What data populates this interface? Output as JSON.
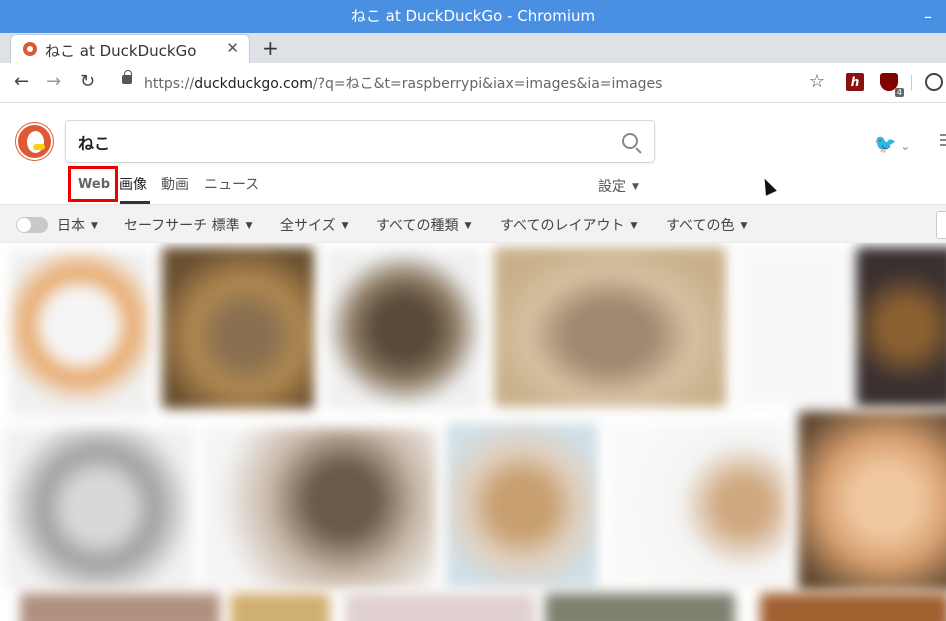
{
  "window": {
    "title": "ねこ at DuckDuckGo - Chromium",
    "minimize_glyph": "–"
  },
  "tab": {
    "title": "ねこ at DuckDuckGo",
    "close_glyph": "✕",
    "new_tab_glyph": "+"
  },
  "toolbar": {
    "back_glyph": "←",
    "forward_glyph": "→",
    "reload_glyph": "↻",
    "url_scheme": "https://",
    "url_host": "duckduckgo.com",
    "url_rest": "/?q=ねこ&t=raspberrypi&iax=images&ia=images",
    "bookmark_glyph": "☆",
    "ext1_label": "h",
    "ext2_badge": "4"
  },
  "search": {
    "value": "ねこ"
  },
  "verticals": [
    {
      "label": "Web"
    },
    {
      "label": "画像"
    },
    {
      "label": "動画"
    },
    {
      "label": "ニュース"
    }
  ],
  "settings_label": "設定",
  "filters": [
    {
      "label": "日本"
    },
    {
      "label": "セーフサーチ 標準"
    },
    {
      "label": "全サイズ"
    },
    {
      "label": "すべての種類"
    },
    {
      "label": "すべてのレイアウト"
    },
    {
      "label": "すべての色"
    }
  ],
  "colors": {
    "titlebar": "#4a90e2",
    "highlight_box": "#e00000",
    "ddg_orange": "#de5833"
  },
  "icons": [
    "duckduckgo-logo",
    "search-icon",
    "twitter-icon",
    "menu-icon",
    "lock-icon",
    "star-icon",
    "profile-icon"
  ]
}
